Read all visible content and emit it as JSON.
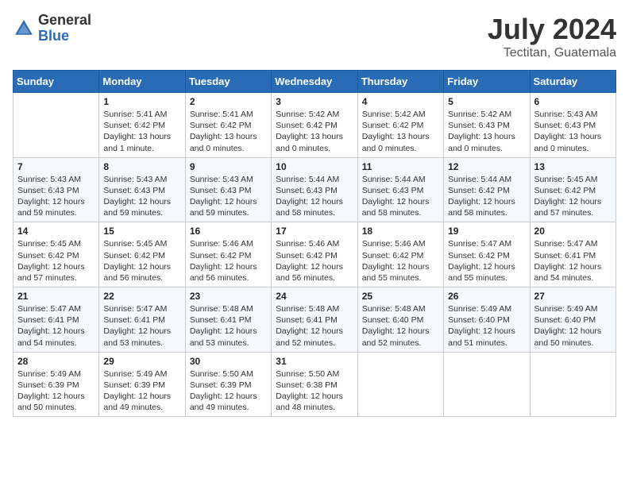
{
  "header": {
    "logo_general": "General",
    "logo_blue": "Blue",
    "month_title": "July 2024",
    "location": "Tectitan, Guatemala"
  },
  "days_of_week": [
    "Sunday",
    "Monday",
    "Tuesday",
    "Wednesday",
    "Thursday",
    "Friday",
    "Saturday"
  ],
  "weeks": [
    [
      {
        "day": "",
        "info": ""
      },
      {
        "day": "1",
        "info": "Sunrise: 5:41 AM\nSunset: 6:42 PM\nDaylight: 13 hours\nand 1 minute."
      },
      {
        "day": "2",
        "info": "Sunrise: 5:41 AM\nSunset: 6:42 PM\nDaylight: 13 hours\nand 0 minutes."
      },
      {
        "day": "3",
        "info": "Sunrise: 5:42 AM\nSunset: 6:42 PM\nDaylight: 13 hours\nand 0 minutes."
      },
      {
        "day": "4",
        "info": "Sunrise: 5:42 AM\nSunset: 6:42 PM\nDaylight: 13 hours\nand 0 minutes."
      },
      {
        "day": "5",
        "info": "Sunrise: 5:42 AM\nSunset: 6:43 PM\nDaylight: 13 hours\nand 0 minutes."
      },
      {
        "day": "6",
        "info": "Sunrise: 5:43 AM\nSunset: 6:43 PM\nDaylight: 13 hours\nand 0 minutes."
      }
    ],
    [
      {
        "day": "7",
        "info": "Sunrise: 5:43 AM\nSunset: 6:43 PM\nDaylight: 12 hours\nand 59 minutes."
      },
      {
        "day": "8",
        "info": "Sunrise: 5:43 AM\nSunset: 6:43 PM\nDaylight: 12 hours\nand 59 minutes."
      },
      {
        "day": "9",
        "info": "Sunrise: 5:43 AM\nSunset: 6:43 PM\nDaylight: 12 hours\nand 59 minutes."
      },
      {
        "day": "10",
        "info": "Sunrise: 5:44 AM\nSunset: 6:43 PM\nDaylight: 12 hours\nand 58 minutes."
      },
      {
        "day": "11",
        "info": "Sunrise: 5:44 AM\nSunset: 6:43 PM\nDaylight: 12 hours\nand 58 minutes."
      },
      {
        "day": "12",
        "info": "Sunrise: 5:44 AM\nSunset: 6:42 PM\nDaylight: 12 hours\nand 58 minutes."
      },
      {
        "day": "13",
        "info": "Sunrise: 5:45 AM\nSunset: 6:42 PM\nDaylight: 12 hours\nand 57 minutes."
      }
    ],
    [
      {
        "day": "14",
        "info": "Sunrise: 5:45 AM\nSunset: 6:42 PM\nDaylight: 12 hours\nand 57 minutes."
      },
      {
        "day": "15",
        "info": "Sunrise: 5:45 AM\nSunset: 6:42 PM\nDaylight: 12 hours\nand 56 minutes."
      },
      {
        "day": "16",
        "info": "Sunrise: 5:46 AM\nSunset: 6:42 PM\nDaylight: 12 hours\nand 56 minutes."
      },
      {
        "day": "17",
        "info": "Sunrise: 5:46 AM\nSunset: 6:42 PM\nDaylight: 12 hours\nand 56 minutes."
      },
      {
        "day": "18",
        "info": "Sunrise: 5:46 AM\nSunset: 6:42 PM\nDaylight: 12 hours\nand 55 minutes."
      },
      {
        "day": "19",
        "info": "Sunrise: 5:47 AM\nSunset: 6:42 PM\nDaylight: 12 hours\nand 55 minutes."
      },
      {
        "day": "20",
        "info": "Sunrise: 5:47 AM\nSunset: 6:41 PM\nDaylight: 12 hours\nand 54 minutes."
      }
    ],
    [
      {
        "day": "21",
        "info": "Sunrise: 5:47 AM\nSunset: 6:41 PM\nDaylight: 12 hours\nand 54 minutes."
      },
      {
        "day": "22",
        "info": "Sunrise: 5:47 AM\nSunset: 6:41 PM\nDaylight: 12 hours\nand 53 minutes."
      },
      {
        "day": "23",
        "info": "Sunrise: 5:48 AM\nSunset: 6:41 PM\nDaylight: 12 hours\nand 53 minutes."
      },
      {
        "day": "24",
        "info": "Sunrise: 5:48 AM\nSunset: 6:41 PM\nDaylight: 12 hours\nand 52 minutes."
      },
      {
        "day": "25",
        "info": "Sunrise: 5:48 AM\nSunset: 6:40 PM\nDaylight: 12 hours\nand 52 minutes."
      },
      {
        "day": "26",
        "info": "Sunrise: 5:49 AM\nSunset: 6:40 PM\nDaylight: 12 hours\nand 51 minutes."
      },
      {
        "day": "27",
        "info": "Sunrise: 5:49 AM\nSunset: 6:40 PM\nDaylight: 12 hours\nand 50 minutes."
      }
    ],
    [
      {
        "day": "28",
        "info": "Sunrise: 5:49 AM\nSunset: 6:39 PM\nDaylight: 12 hours\nand 50 minutes."
      },
      {
        "day": "29",
        "info": "Sunrise: 5:49 AM\nSunset: 6:39 PM\nDaylight: 12 hours\nand 49 minutes."
      },
      {
        "day": "30",
        "info": "Sunrise: 5:50 AM\nSunset: 6:39 PM\nDaylight: 12 hours\nand 49 minutes."
      },
      {
        "day": "31",
        "info": "Sunrise: 5:50 AM\nSunset: 6:38 PM\nDaylight: 12 hours\nand 48 minutes."
      },
      {
        "day": "",
        "info": ""
      },
      {
        "day": "",
        "info": ""
      },
      {
        "day": "",
        "info": ""
      }
    ]
  ]
}
